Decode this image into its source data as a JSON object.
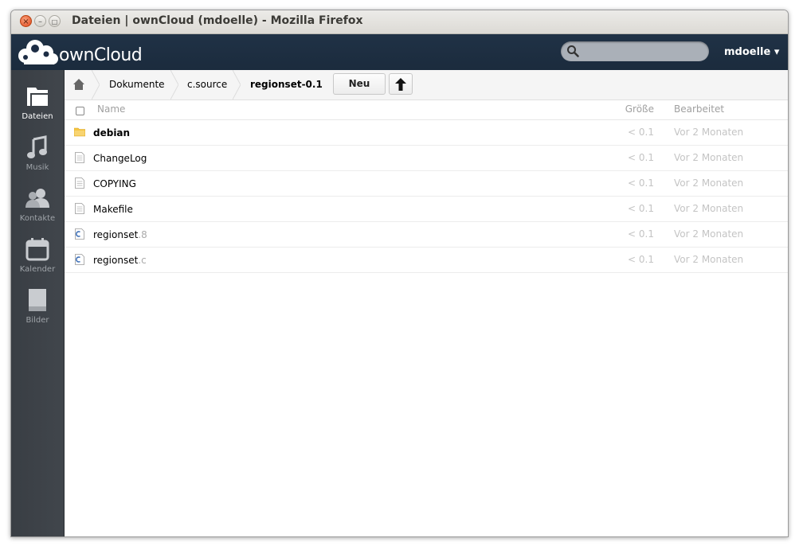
{
  "window": {
    "title": "Dateien | ownCloud (mdoelle) - Mozilla Firefox",
    "close_glyph": "×",
    "min_glyph": "–",
    "max_glyph": "□"
  },
  "header": {
    "logo_text": "ownCloud",
    "search_placeholder": "",
    "user": "mdoelle ▾"
  },
  "sidebar": {
    "items": [
      {
        "label": "Dateien",
        "icon": "folder-icon",
        "active": true
      },
      {
        "label": "Musik",
        "icon": "music-icon",
        "active": false
      },
      {
        "label": "Kontakte",
        "icon": "contacts-icon",
        "active": false
      },
      {
        "label": "Kalender",
        "icon": "calendar-icon",
        "active": false
      },
      {
        "label": "Bilder",
        "icon": "pictures-icon",
        "active": false
      }
    ]
  },
  "breadcrumb": {
    "home_icon": "home-icon",
    "items": [
      "Dokumente",
      "c.source",
      "regionset-0.1"
    ]
  },
  "toolbar": {
    "new_label": "Neu",
    "upload_icon": "upload-arrow-icon"
  },
  "table": {
    "headers": {
      "name": "Name",
      "size": "Größe",
      "modified": "Bearbeitet"
    },
    "rows": [
      {
        "name": "debian",
        "ext": "",
        "type": "folder",
        "size": "< 0.1",
        "modified": "Vor 2 Monaten"
      },
      {
        "name": "ChangeLog",
        "ext": "",
        "type": "text",
        "size": "< 0.1",
        "modified": "Vor 2 Monaten"
      },
      {
        "name": "COPYING",
        "ext": "",
        "type": "text",
        "size": "< 0.1",
        "modified": "Vor 2 Monaten"
      },
      {
        "name": "Makefile",
        "ext": "",
        "type": "text",
        "size": "< 0.1",
        "modified": "Vor 2 Monaten"
      },
      {
        "name": "regionset",
        "ext": ".8",
        "type": "c",
        "size": "< 0.1",
        "modified": "Vor 2 Monaten"
      },
      {
        "name": "regionset",
        "ext": ".c",
        "type": "c",
        "size": "< 0.1",
        "modified": "Vor 2 Monaten"
      }
    ]
  },
  "colors": {
    "header_bg": "#1d2d44",
    "sidebar_bg": "#3c4146",
    "folder": "#f5c542"
  }
}
